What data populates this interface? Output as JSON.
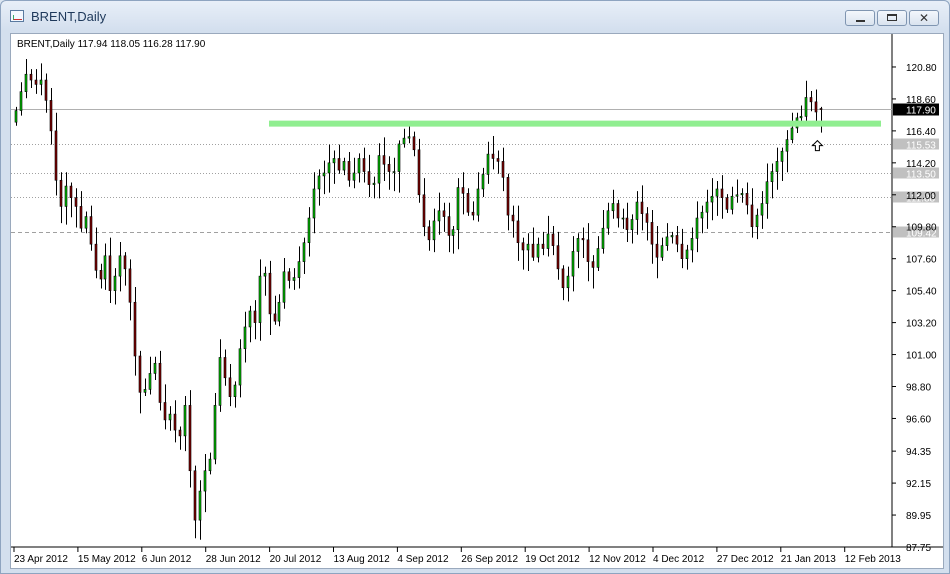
{
  "window": {
    "title": "BRENT,Daily"
  },
  "header_text": "BRENT,Daily  117.94 118.05 116.28 117.90",
  "colors": {
    "bull": "#00c000",
    "bear": "#800000",
    "resistance": "#90ee90",
    "current_price_bg": "#000000",
    "level_label_bg": "#c0c0c0",
    "level_line": "#a0a0a0"
  },
  "chart_data": {
    "type": "candlestick",
    "symbol": "BRENT",
    "timeframe": "Daily",
    "last_bar": {
      "open": 117.94,
      "high": 118.05,
      "low": 116.28,
      "close": 117.9
    },
    "ylim": [
      87.75,
      121.9
    ],
    "y_ticks": [
      "120.80",
      "118.60",
      "116.40",
      "114.20",
      "112.00",
      "109.80",
      "107.60",
      "105.40",
      "103.20",
      "101.00",
      "98.80",
      "96.60",
      "94.35",
      "92.15",
      "89.95",
      "87.75"
    ],
    "x_ticks": [
      "23 Apr 2012",
      "15 May 2012",
      "6 Jun 2012",
      "28 Jun 2012",
      "20 Jul 2012",
      "13 Aug 2012",
      "4 Sep 2012",
      "26 Sep 2012",
      "19 Oct 2012",
      "12 Nov 2012",
      "4 Dec 2012",
      "27 Dec 2012",
      "21 Jan 2013",
      "12 Feb 2013"
    ],
    "current_price": {
      "value": 117.9,
      "label": "117.90"
    },
    "horizontal_levels": [
      {
        "value": 115.53,
        "label": "115.53",
        "style": "dotted"
      },
      {
        "value": 113.5,
        "label": "113.50",
        "style": "dotted"
      },
      {
        "value": 111.88,
        "label": "111.88",
        "style": "dotted"
      },
      {
        "value": 109.42,
        "label": "109.42",
        "style": "dashed"
      }
    ],
    "resistance_level": 116.9,
    "annotation": "up-arrow",
    "closes": [
      117.8,
      119.1,
      120.3,
      119.9,
      119.6,
      119.9,
      118.5,
      116.4,
      113.0,
      111.2,
      112.6,
      111.8,
      111.2,
      109.7,
      110.5,
      108.6,
      106.8,
      106.2,
      107.8,
      105.4,
      106.4,
      107.8,
      106.9,
      104.6,
      100.9,
      98.4,
      98.6,
      99.7,
      100.4,
      97.7,
      96.5,
      96.9,
      95.8,
      95.4,
      97.5,
      93.0,
      89.6,
      91.6,
      93.0,
      93.8,
      97.5,
      100.8,
      99.4,
      98.1,
      98.9,
      101.4,
      102.9,
      104.0,
      103.2,
      106.4,
      106.6,
      103.8,
      103.3,
      104.6,
      106.7,
      106.1,
      106.3,
      107.4,
      108.7,
      110.4,
      112.4,
      113.3,
      113.5,
      114.2,
      114.5,
      113.7,
      114.3,
      113.0,
      113.5,
      114.5,
      113.6,
      112.7,
      112.8,
      114.7,
      114.1,
      113.6,
      113.6,
      115.5,
      115.9,
      116.0,
      115.1,
      112.0,
      109.8,
      108.9,
      110.2,
      110.9,
      110.5,
      109.2,
      109.6,
      112.5,
      112.1,
      110.8,
      110.6,
      112.4,
      113.4,
      114.8,
      114.5,
      114.3,
      113.2,
      110.6,
      110.2,
      108.7,
      108.2,
      108.6,
      107.7,
      108.6,
      108.3,
      109.3,
      108.5,
      106.9,
      105.6,
      106.4,
      108.1,
      109.0,
      108.9,
      107.4,
      107.0,
      108.3,
      109.7,
      110.9,
      111.4,
      110.4,
      110.4,
      109.6,
      110.3,
      111.5,
      110.7,
      110.1,
      108.6,
      107.7,
      108.5,
      109.1,
      109.2,
      108.6,
      107.6,
      108.2,
      109.0,
      110.4,
      110.8,
      111.5,
      111.9,
      112.4,
      111.8,
      111.0,
      111.9,
      112.0,
      112.1,
      111.3,
      109.8,
      110.6,
      111.4,
      112.9,
      113.6,
      114.3,
      115.0,
      115.8,
      116.6,
      117.3,
      117.4,
      118.7,
      118.4,
      117.7,
      117.9
    ]
  }
}
